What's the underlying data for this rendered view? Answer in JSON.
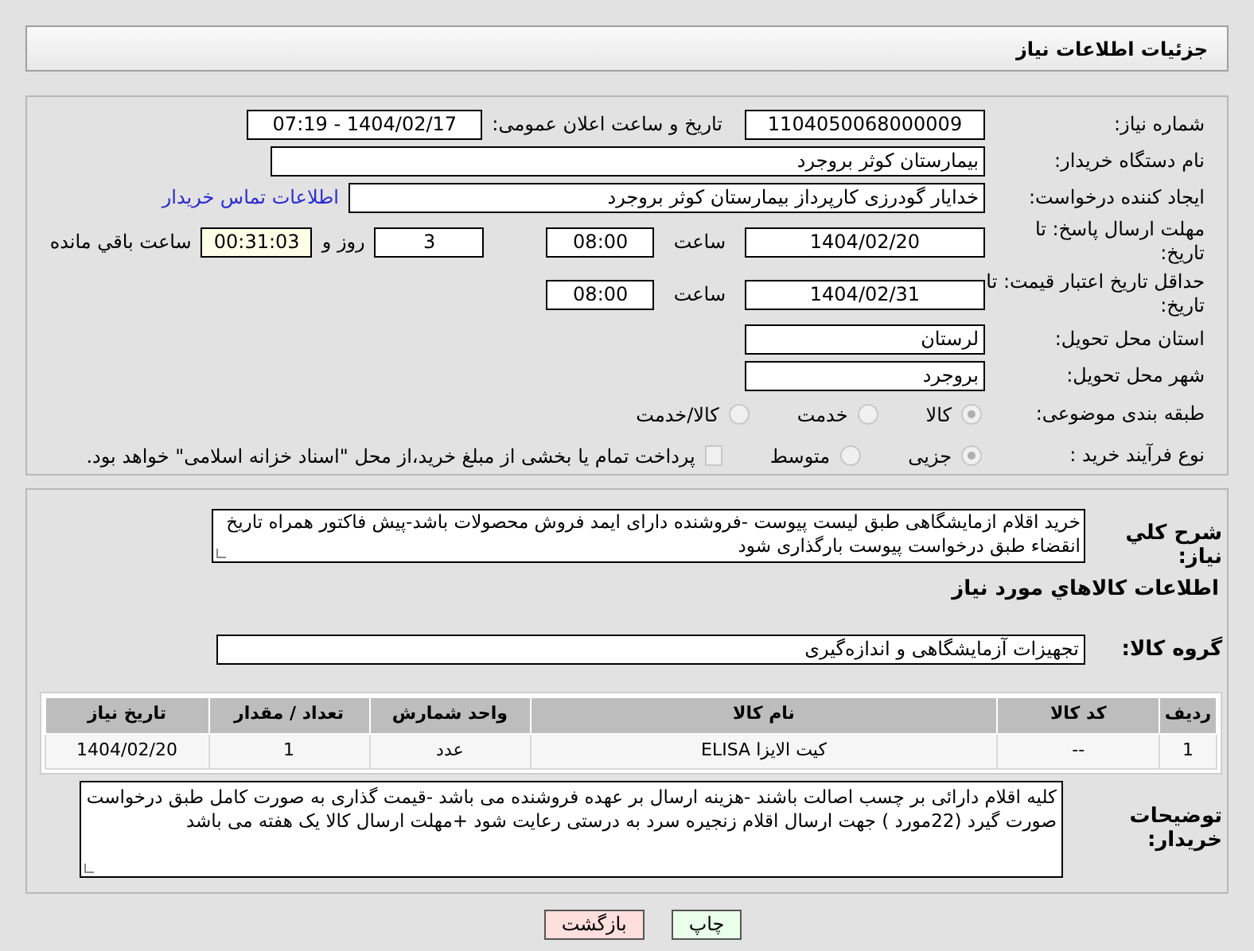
{
  "header": {
    "title": "جزئیات اطلاعات نیاز"
  },
  "need_number": {
    "label": "شماره نیاز:",
    "value": "1104050068000009"
  },
  "announce": {
    "label": "تاریخ و ساعت اعلان عمومی:",
    "value": "1404/02/17 - 07:19"
  },
  "buyer": {
    "label": "نام دستگاه خریدار:",
    "value": "بیمارستان کوثر بروجرد"
  },
  "creator": {
    "label": "ایجاد کننده درخواست:",
    "value": "خدایار  گودرزی کارپرداز بیمارستان کوثر بروجرد",
    "link": "اطلاعات تماس خریدار"
  },
  "deadline": {
    "label": "مهلت ارسال پاسخ: تا تاریخ:",
    "date": "1404/02/20",
    "time_label": "ساعت",
    "time": "08:00",
    "days": "3",
    "days_label": "روز و",
    "remaining": "00:31:03",
    "remaining_label": "ساعت باقي مانده"
  },
  "validity": {
    "label": "حداقل تاریخ اعتبار قیمت: تا تاریخ:",
    "date": "1404/02/31",
    "time_label": "ساعت",
    "time": "08:00"
  },
  "province": {
    "label": "استان محل تحویل:",
    "value": "لرستان"
  },
  "city": {
    "label": "شهر محل تحویل:",
    "value": "بروجرد"
  },
  "category": {
    "label": "طبقه بندی موضوعی:",
    "options": [
      {
        "label": "کالا",
        "selected": true
      },
      {
        "label": "خدمت",
        "selected": false
      },
      {
        "label": "کالا/خدمت",
        "selected": false
      }
    ]
  },
  "process": {
    "label": "نوع فرآیند خرید :",
    "options": [
      {
        "label": "جزیی",
        "selected": true
      },
      {
        "label": "متوسط",
        "selected": false
      }
    ],
    "treasury": {
      "checked": false,
      "text": "پرداخت تمام یا بخشی از مبلغ خرید،از محل \"اسناد خزانه اسلامی\" خواهد بود."
    }
  },
  "description": {
    "label": "شرح کلي نیاز:",
    "value": "خرید اقلام ازمایشگاهی طبق لیست پیوست -فروشنده دارای ایمد فروش محصولات باشد-پیش فاکتور همراه تاریخ انقضاء طبق درخواست پیوست بارگذاری شود"
  },
  "goods_heading": "اطلاعات کالاهاي مورد نیاز",
  "goods_group": {
    "label": "گروه کالا:",
    "value": "تجهیزات آزمایشگاهی و اندازه‌گیری"
  },
  "table": {
    "columns": [
      "ردیف",
      "کد کالا",
      "نام کالا",
      "واحد شمارش",
      "تعداد / مقدار",
      "تاریخ نیاز"
    ],
    "rows": [
      [
        "1",
        "--",
        "کیت الایزا ELISA",
        "عدد",
        "1",
        "1404/02/20"
      ]
    ]
  },
  "buyer_notes": {
    "label": "توضیحات خریدار:",
    "value": "کلیه اقلام دارائی بر چسب اصالت باشند -هزینه ارسال بر عهده فروشنده می باشد -قیمت گذاری به صورت کامل طبق درخواست صورت گیرد (22مورد ) جهت ارسال اقلام زنجیره سرد به درستی رعایت شود +مهلت ارسال کالا یک هفته می باشد"
  },
  "buttons": [
    {
      "kind": "print",
      "label": "چاپ"
    },
    {
      "kind": "back",
      "label": "بازگشت"
    }
  ]
}
